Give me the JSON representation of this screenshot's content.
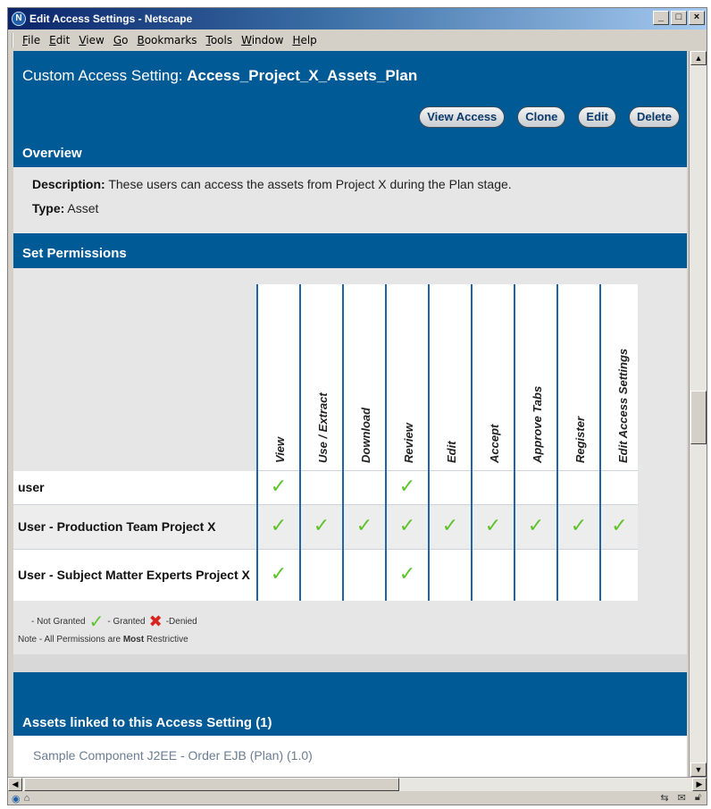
{
  "window": {
    "title": "Edit Access Settings - Netscape",
    "controls": {
      "minimize": "_",
      "maximize": "□",
      "close": "×"
    }
  },
  "menu": [
    {
      "label": "File",
      "accel": "F",
      "rest": "ile"
    },
    {
      "label": "Edit",
      "accel": "E",
      "rest": "dit"
    },
    {
      "label": "View",
      "accel": "V",
      "rest": "iew"
    },
    {
      "label": "Go",
      "accel": "G",
      "rest": "o"
    },
    {
      "label": "Bookmarks",
      "accel": "B",
      "rest": "ookmarks"
    },
    {
      "label": "Tools",
      "accel": "T",
      "rest": "ools"
    },
    {
      "label": "Window",
      "accel": "W",
      "rest": "indow"
    },
    {
      "label": "Help",
      "accel": "H",
      "rest": "elp"
    }
  ],
  "page": {
    "title_prefix": "Custom Access Setting: ",
    "title_name": "Access_Project_X_Assets_Plan"
  },
  "actions": {
    "view_access": "View Access",
    "clone": "Clone",
    "edit": "Edit",
    "delete": "Delete"
  },
  "overview": {
    "heading": "Overview",
    "description_label": "Description:",
    "description": " These users can access the assets from Project X during the Plan stage.",
    "type_label": "Type:",
    "type": " Asset"
  },
  "permissions": {
    "heading": "Set Permissions",
    "columns": [
      "View",
      "Use / Extract",
      "Download",
      "Review",
      "Edit",
      "Accept",
      "Approve Tabs",
      "Register",
      "Edit Access Settings"
    ],
    "rows": [
      {
        "name": "user",
        "granted": [
          true,
          false,
          false,
          true,
          false,
          false,
          false,
          false,
          false
        ]
      },
      {
        "name": "User - Production Team Project X",
        "granted": [
          true,
          true,
          true,
          true,
          true,
          true,
          true,
          true,
          true
        ]
      },
      {
        "name": "User - Subject Matter Experts Project X",
        "granted": [
          true,
          false,
          false,
          true,
          false,
          false,
          false,
          false,
          false
        ]
      }
    ],
    "legend": {
      "not_granted": "- Not Granted",
      "granted": "- Granted",
      "denied": "-Denied",
      "note_prefix": "Note - All Permissions are ",
      "note_bold": "Most",
      "note_suffix": " Restrictive"
    }
  },
  "assets": {
    "heading": "Assets linked to this Access Setting (1)",
    "items": [
      "Sample Component J2EE - Order EJB (Plan) (1.0)"
    ]
  },
  "colors": {
    "page_blue": "#005a96",
    "panel_gray": "#e6e6e6",
    "check_green": "#5fc22a",
    "deny_red": "#d9231f",
    "link_gray": "#6a7d92"
  },
  "icons": {
    "check": "✓",
    "cross": "✖",
    "netscape": "N"
  }
}
